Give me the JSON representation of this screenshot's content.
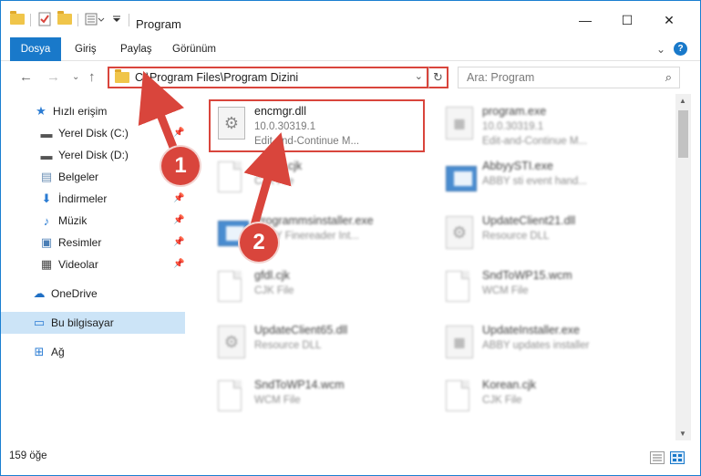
{
  "window": {
    "title": "Program",
    "minimize": "—",
    "maximize": "☐",
    "close": "✕"
  },
  "ribbon": {
    "tabs": [
      "Dosya",
      "Giriş",
      "Paylaş",
      "Görünüm"
    ],
    "expand": "⌄",
    "help": "?"
  },
  "nav": {
    "back": "←",
    "forward": "→",
    "recent": "⌄",
    "up": "↑",
    "path": "C:\\Program Files\\Program Dizini",
    "dropdown": "⌄",
    "refresh": "↻",
    "search_placeholder": "Ara: Program",
    "search_icon": "⌕"
  },
  "sidebar": {
    "items": [
      {
        "label": "Hızlı erişim",
        "icon": "star-icon",
        "glyph": "★",
        "color": "#2b7cd3"
      },
      {
        "label": "Yerel Disk (C:)",
        "icon": "drive-icon",
        "glyph": "▬",
        "color": "#555555",
        "pinned": true
      },
      {
        "label": "Yerel Disk (D:)",
        "icon": "drive-icon",
        "glyph": "▬",
        "color": "#555555"
      },
      {
        "label": "Belgeler",
        "icon": "documents-icon",
        "glyph": "▤",
        "color": "#6b8fb5"
      },
      {
        "label": "İndirmeler",
        "icon": "downloads-icon",
        "glyph": "⬇",
        "color": "#2b7cd3",
        "pinned": true
      },
      {
        "label": "Müzik",
        "icon": "music-icon",
        "glyph": "♪",
        "color": "#2b7cd3",
        "pinned": true
      },
      {
        "label": "Resimler",
        "icon": "pictures-icon",
        "glyph": "▣",
        "color": "#4a7eb5",
        "pinned": true
      },
      {
        "label": "Videolar",
        "icon": "videos-icon",
        "glyph": "▦",
        "color": "#444444",
        "pinned": true
      },
      {
        "label": "OneDrive",
        "icon": "onedrive-icon",
        "glyph": "☁",
        "color": "#1f6fc4"
      },
      {
        "label": "Bu bilgisayar",
        "icon": "computer-icon",
        "glyph": "▭",
        "color": "#2b7cd3",
        "selected": true
      },
      {
        "label": "Ağ",
        "icon": "network-icon",
        "glyph": "⊞",
        "color": "#2b7cd3"
      }
    ]
  },
  "files": [
    {
      "name": "encmgr.dll",
      "line2": "10.0.30319.1",
      "line3": "Edit-and-Continue M...",
      "kind": "dll"
    },
    {
      "name": "program.exe",
      "line2": "10.0.30319.1",
      "line3": "Edit-and-Continue M...",
      "kind": "exe",
      "blur": true
    },
    {
      "name": "Italian.cjk",
      "line2": "CJK File",
      "line3": "",
      "kind": "doc",
      "blur": true
    },
    {
      "name": "AbbyySTI.exe",
      "line2": "ABBY sti event hand...",
      "line3": "",
      "kind": "app",
      "blur": true
    },
    {
      "name": "Programmsinstaller.exe",
      "line2": "ABBY Finereader Int...",
      "line3": "",
      "kind": "app",
      "blur": true
    },
    {
      "name": "UpdateClient21.dll",
      "line2": "Resource DLL",
      "line3": "",
      "kind": "dll",
      "blur": true
    },
    {
      "name": "gfdl.cjk",
      "line2": "CJK File",
      "line3": "",
      "kind": "doc",
      "blur": true
    },
    {
      "name": "SndToWP15.wcm",
      "line2": "WCM File",
      "line3": "",
      "kind": "doc",
      "blur": true
    },
    {
      "name": "UpdateClient65.dll",
      "line2": "Resource DLL",
      "line3": "",
      "kind": "dll",
      "blur": true
    },
    {
      "name": "UpdateInstaller.exe",
      "line2": "ABBY updates installer",
      "line3": "",
      "kind": "exe",
      "blur": true
    },
    {
      "name": "SndToWP14.wcm",
      "line2": "WCM File",
      "line3": "",
      "kind": "doc",
      "blur": true
    },
    {
      "name": "Korean.cjk",
      "line2": "CJK File",
      "line3": "",
      "kind": "doc",
      "blur": true
    }
  ],
  "status": {
    "count": "159 öğe"
  },
  "callouts": [
    "1",
    "2"
  ],
  "colors": {
    "accent": "#1979ca",
    "highlight": "#d9453c",
    "selection": "#cce4f7"
  }
}
